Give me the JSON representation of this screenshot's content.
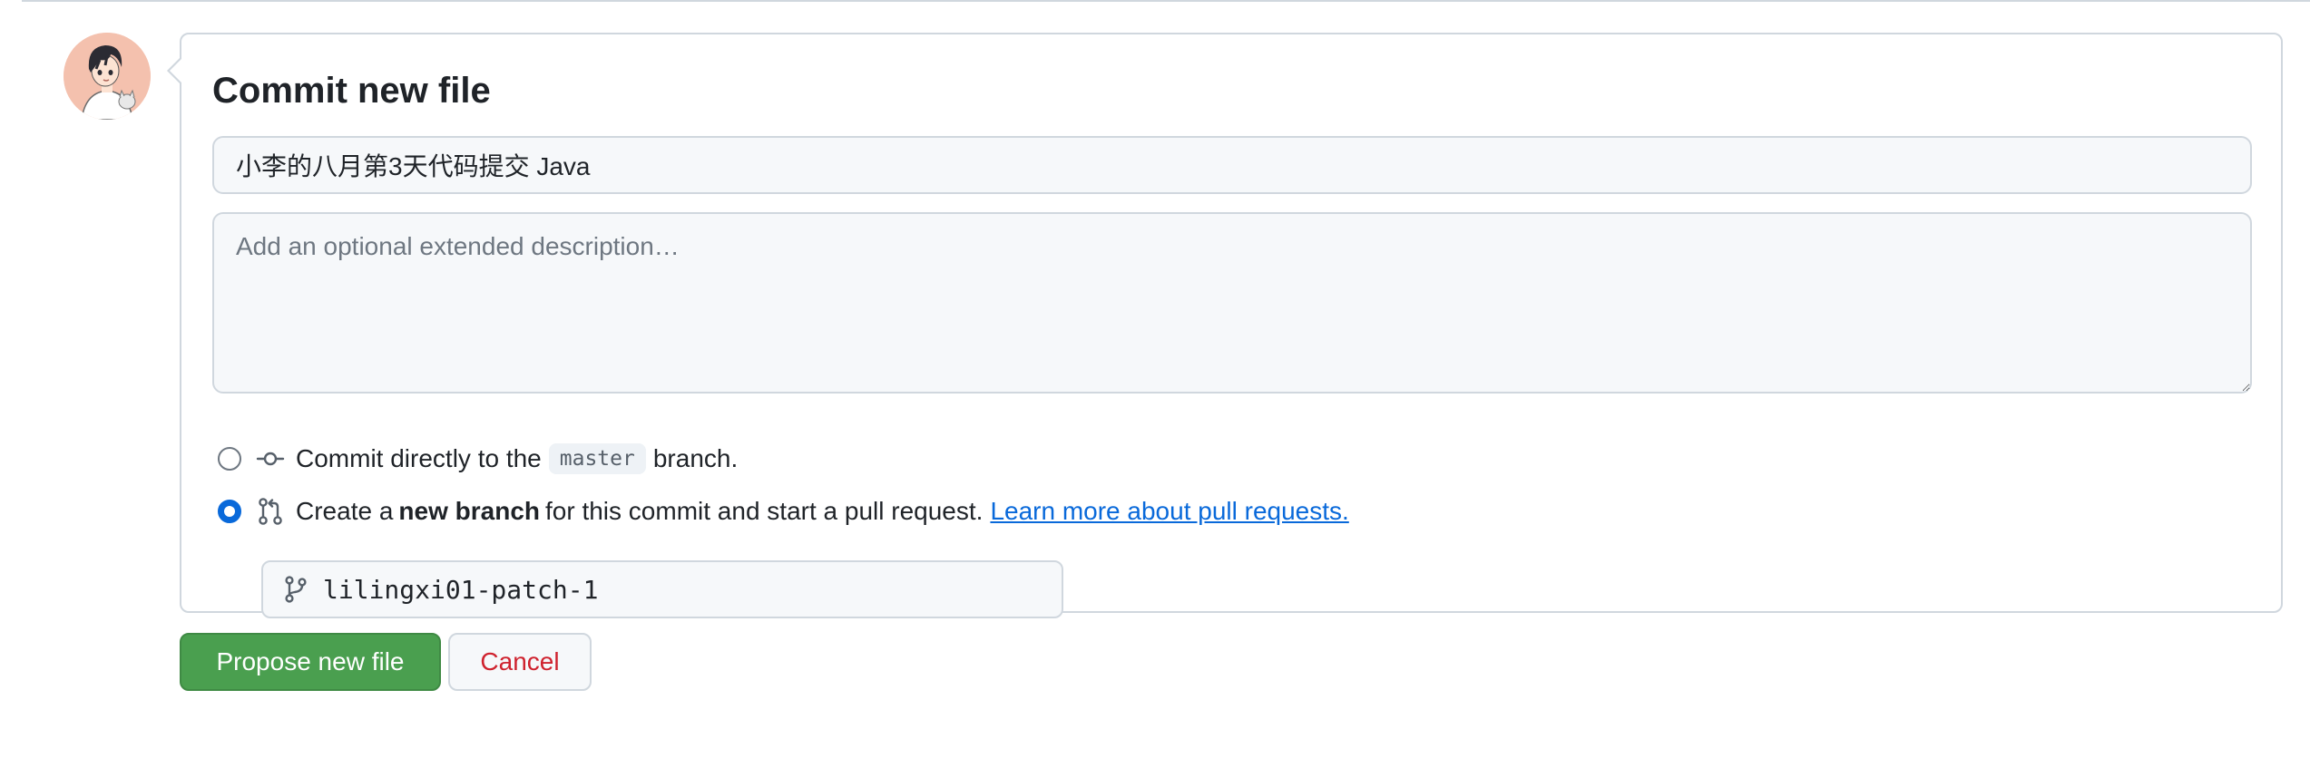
{
  "commit_form": {
    "title": "Commit new file",
    "summary_value": "小李的八月第3天代码提交 Java",
    "description_placeholder": "Add an optional extended description…",
    "option_direct": {
      "prefix": "Commit directly to the",
      "branch": "master",
      "suffix": "branch.",
      "checked": false
    },
    "option_new_branch": {
      "prefix": "Create a",
      "emphasis": "new branch",
      "suffix": "for this commit and start a pull request.",
      "link": "Learn more about pull requests.",
      "checked": true
    },
    "branch_name_value": "lilingxi01-patch-1"
  },
  "actions": {
    "propose_label": "Propose new file",
    "cancel_label": "Cancel"
  },
  "colors": {
    "primary_button": "#4a9f4f",
    "link": "#0969da",
    "danger_text": "#cf222e",
    "radio_checked": "#0969da"
  },
  "icons": {
    "commit_option": "git-commit-icon",
    "pull_request_option": "git-pull-request-icon",
    "branch_field": "git-branch-icon"
  }
}
